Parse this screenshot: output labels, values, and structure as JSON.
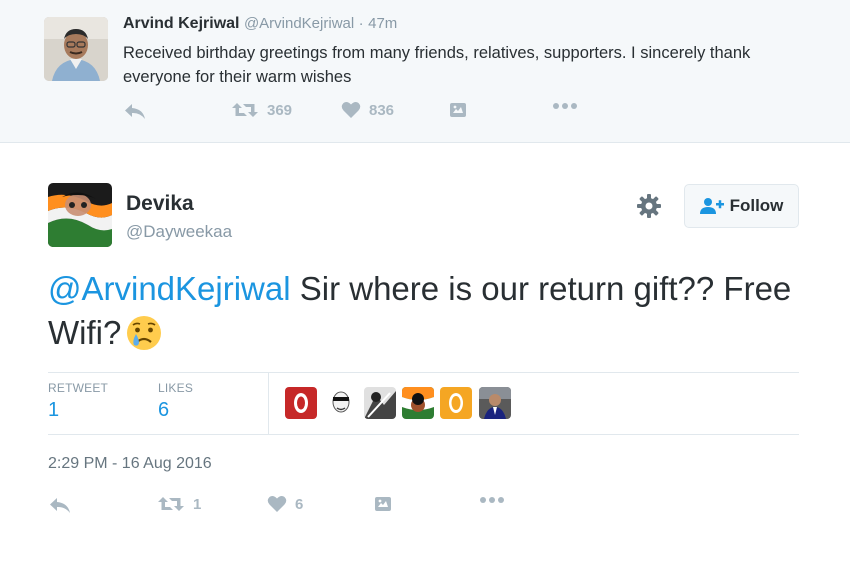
{
  "parent_tweet": {
    "name": "Arvind Kejriwal",
    "handle": "@ArvindKejriwal",
    "separator": "·",
    "time": "47m",
    "text": "Received birthday greetings from many friends, relatives, supporters. I sincerely thank everyone for their warm wishes",
    "retweets": "369",
    "likes": "836"
  },
  "main_tweet": {
    "name": "Devika",
    "handle": "@Dayweekaa",
    "follow_label": "Follow",
    "mention": "@ArvindKejriwal",
    "text": " Sir where is our return gift?? Free Wifi?",
    "stats": {
      "retweet_label": "RETWEET",
      "retweet_count": "1",
      "likes_label": "LIKES",
      "likes_count": "6"
    },
    "date": "2:29 PM - 16 Aug 2016",
    "action_retweets": "1",
    "action_likes": "6"
  },
  "icons": {
    "reply": "reply-icon",
    "retweet": "retweet-icon",
    "like": "heart-icon",
    "moment": "moment-icon",
    "more": "more-icon",
    "settings": "gear-icon",
    "follow": "add-user-icon",
    "emoji": "crying-face-emoji"
  },
  "colors": {
    "link": "#1b95e0",
    "muted": "#8899a6",
    "action_gray": "#aab8c2",
    "parent_bg": "#f5f8fa"
  }
}
